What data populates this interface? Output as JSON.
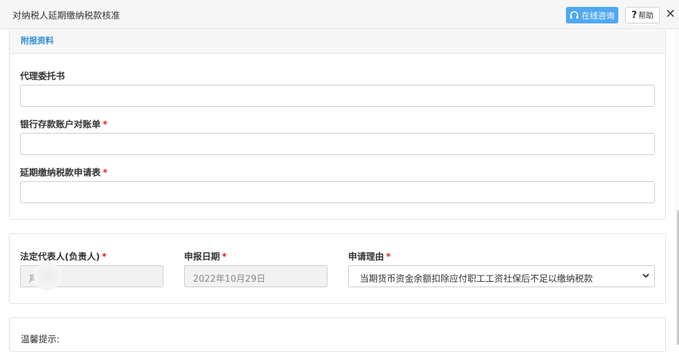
{
  "window": {
    "title": "对纳税人延期缴纳税款核准",
    "consult_label": "在线咨询",
    "help_label": "帮助",
    "close_glyph": "✕"
  },
  "attachments": {
    "section_title": "附报资料",
    "fields": [
      {
        "label": "代理委托书",
        "required": false,
        "value": ""
      },
      {
        "label": "银行存款账户对账单",
        "required": true,
        "value": ""
      },
      {
        "label": "延期缴纳税款申请表",
        "required": true,
        "value": ""
      }
    ]
  },
  "info": {
    "legal_rep_label": "法定代表人(负责人)",
    "legal_rep_value": "声",
    "report_date_label": "申报日期",
    "report_date_value": "2022年10月29日",
    "reason_label": "申请理由",
    "reason_value": "当期货币资金余额扣除应付职工工资社保后不足以缴纳税款"
  },
  "tip": {
    "label": "温馨提示:"
  },
  "required_mark": "*",
  "colors": {
    "accent": "#4fa8f2",
    "section_title": "#2f8fd8",
    "required": "#e02020"
  },
  "icons": {
    "consult": "headset-icon",
    "help": "question-icon",
    "close": "close-icon",
    "select": "chevron-down-icon"
  }
}
